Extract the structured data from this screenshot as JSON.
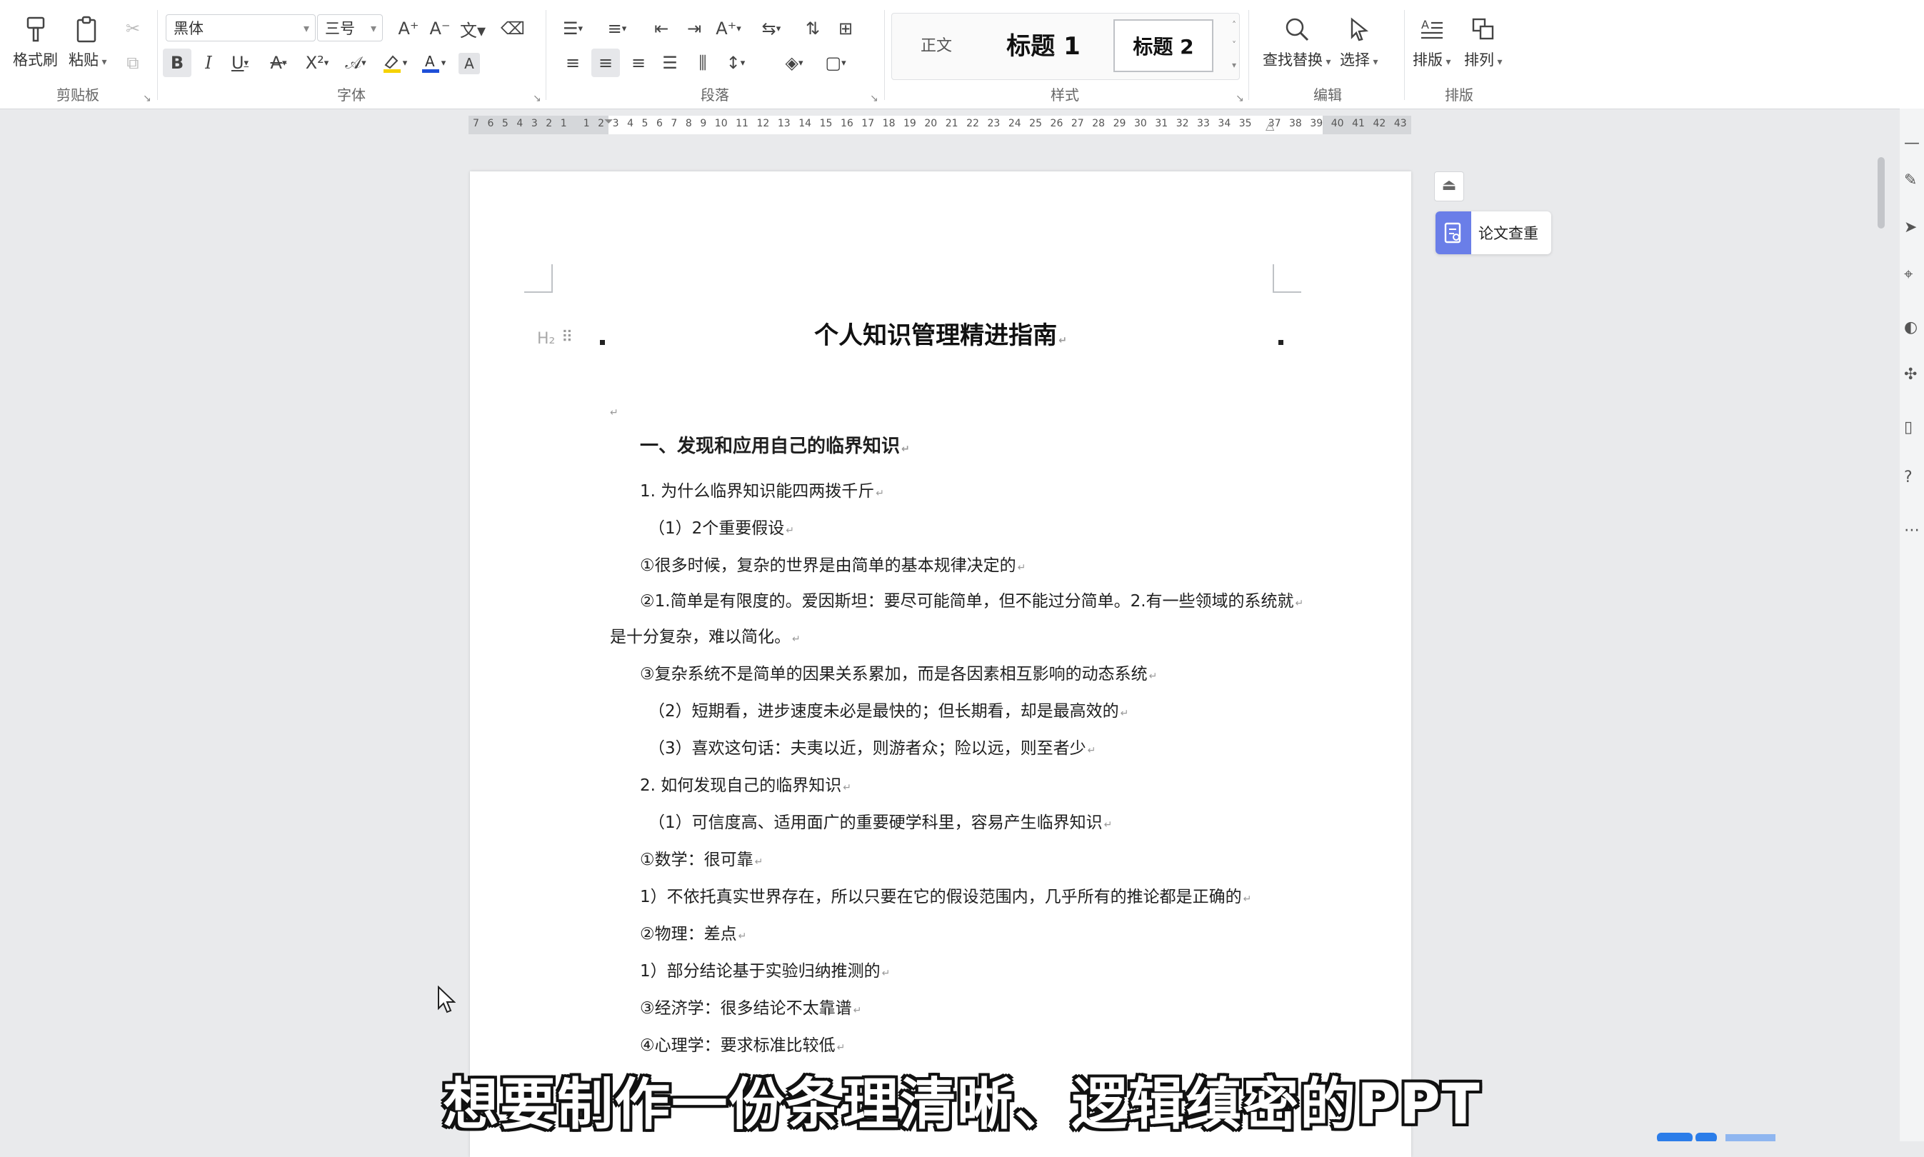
{
  "ribbon": {
    "clipboard": {
      "group_label": "剪贴板",
      "format_painter": "格式刷",
      "paste": "粘贴"
    },
    "font": {
      "group_label": "字体",
      "font_name": "黑体",
      "font_size": "三号",
      "bold": "B",
      "italic": "I",
      "underline": "U",
      "strike": "A",
      "super": "X²",
      "highlight_color": "#f5d200",
      "font_color": "#1f4fd8"
    },
    "paragraph": {
      "group_label": "段落"
    },
    "styles": {
      "group_label": "样式",
      "normal": "正文",
      "heading1": "标题 1",
      "heading2": "标题 2"
    },
    "edit": {
      "group_label": "编辑",
      "find_replace": "查找替换",
      "select": "选择"
    },
    "layout": {
      "group_label": "排版",
      "typeset": "排版",
      "arrange": "排列"
    }
  },
  "ruler": {
    "numbers": [
      "7",
      "6",
      "5",
      "4",
      "3",
      "2",
      "1",
      "",
      "1",
      "2",
      "3",
      "4",
      "5",
      "6",
      "7",
      "8",
      "9",
      "10",
      "11",
      "12",
      "13",
      "14",
      "15",
      "16",
      "17",
      "18",
      "19",
      "20",
      "21",
      "22",
      "23",
      "24",
      "25",
      "26",
      "27",
      "28",
      "29",
      "30",
      "31",
      "32",
      "33",
      "34",
      "35",
      "",
      "37",
      "38",
      "39",
      "40",
      "41",
      "42",
      "43"
    ]
  },
  "document": {
    "h2_tag": "H₂",
    "title": "个人知识管理精进指南",
    "lines": [
      "一、发现和应用自己的临界知识",
      "1. 为什么临界知识能四两拨千斤",
      "（1）2个重要假设",
      "①很多时候，复杂的世界是由简单的基本规律决定的",
      "②1.简单是有限度的。爱因斯坦：要尽可能简单，但不能过分简单。2.有一些领域的系统就",
      "是十分复杂，难以简化。",
      "③复杂系统不是简单的因果关系累加，而是各因素相互影响的动态系统",
      "（2）短期看，进步速度未必是最快的；但长期看，却是最高效的",
      "（3）喜欢这句话：夫夷以近，则游者众；险以远，则至者少",
      "2. 如何发现自己的临界知识",
      "（1）可信度高、适用面广的重要硬学科里，容易产生临界知识",
      "①数学：很可靠",
      "1）不依托真实世界存在，所以只要在它的假设范围内，几乎所有的推论都是正确的",
      "②物理：差点",
      "1）部分结论基于实验归纳推测的",
      "③经济学：很多结论不太靠谱",
      "④心理学：要求标准比较低"
    ]
  },
  "side_panel": {
    "paper_check": "论文查重"
  },
  "subtitle": "想要制作一份条理清晰、逻辑缜密的PPT"
}
